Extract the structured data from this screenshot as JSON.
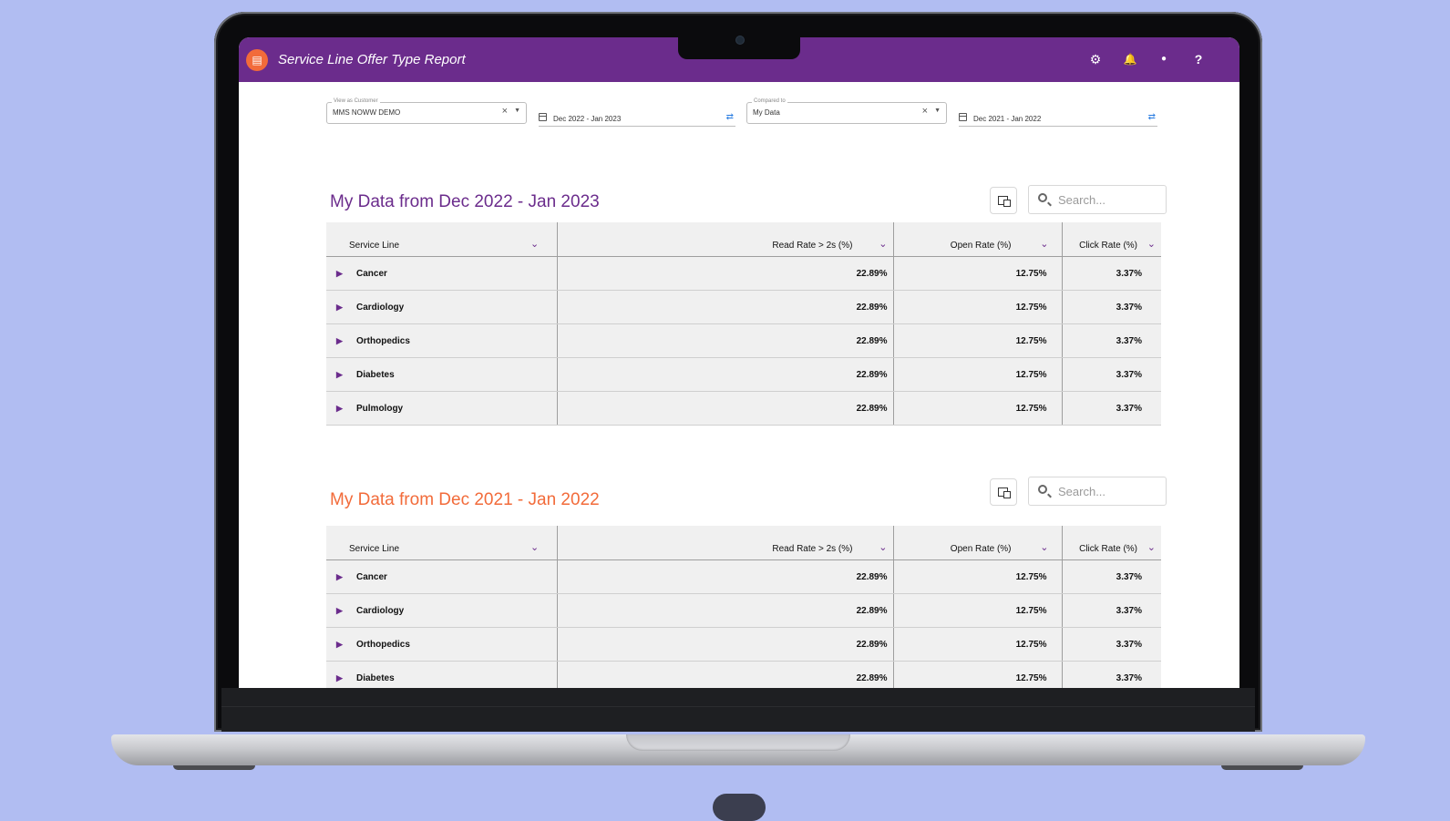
{
  "app": {
    "title": "Service Line Offer Type Report",
    "logo_glyph": "▤",
    "brand_color": "#6b2c8c",
    "accent_color": "#f26b3a"
  },
  "header_icons": [
    "gear-icon",
    "bell-icon",
    "user-icon",
    "help-icon"
  ],
  "header_icon_glyphs": {
    "gear": "⚙",
    "bell": "🔔",
    "user": "●",
    "help": "?"
  },
  "filters": {
    "customer_label": "View as Customer",
    "customer_value": "MMS NOWW DEMO",
    "date_range": "Dec 2022 - Jan 2023",
    "compare_label": "Compared to",
    "compare_value": "My Data",
    "compare_date_range": "Dec 2021 - Jan 2022"
  },
  "columns": {
    "service_line": "Service Line",
    "read_rate": "Read Rate > 2s (%)",
    "open_rate": "Open Rate (%)",
    "click_rate": "Click Rate (%)"
  },
  "section1": {
    "title": "My Data from Dec 2022 - Jan 2023",
    "search_placeholder": "Search...",
    "rows": [
      {
        "name": "Cancer",
        "read": "22.89%",
        "open": "12.75%",
        "click": "3.37%"
      },
      {
        "name": "Cardiology",
        "read": "22.89%",
        "open": "12.75%",
        "click": "3.37%"
      },
      {
        "name": "Orthopedics",
        "read": "22.89%",
        "open": "12.75%",
        "click": "3.37%"
      },
      {
        "name": "Diabetes",
        "read": "22.89%",
        "open": "12.75%",
        "click": "3.37%"
      },
      {
        "name": "Pulmology",
        "read": "22.89%",
        "open": "12.75%",
        "click": "3.37%"
      }
    ]
  },
  "section2": {
    "title": "My Data from Dec 2021 - Jan 2022",
    "search_placeholder": "Search...",
    "rows": [
      {
        "name": "Cancer",
        "read": "22.89%",
        "open": "12.75%",
        "click": "3.37%"
      },
      {
        "name": "Cardiology",
        "read": "22.89%",
        "open": "12.75%",
        "click": "3.37%"
      },
      {
        "name": "Orthopedics",
        "read": "22.89%",
        "open": "12.75%",
        "click": "3.37%"
      },
      {
        "name": "Diabetes",
        "read": "22.89%",
        "open": "12.75%",
        "click": "3.37%"
      }
    ]
  }
}
